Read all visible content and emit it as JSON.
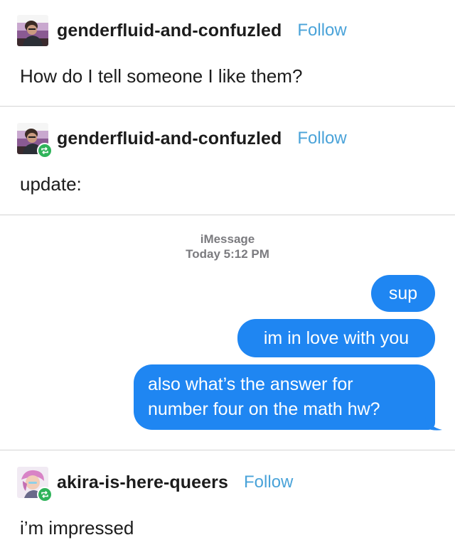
{
  "posts": [
    {
      "username": "genderfluid-and-confuzled",
      "follow_label": "Follow",
      "text": "How do I tell someone I like them?",
      "reblogged": false
    },
    {
      "username": "genderfluid-and-confuzled",
      "follow_label": "Follow",
      "text": "update:",
      "reblogged": true
    },
    {
      "username": "akira-is-here-queers",
      "follow_label": "Follow",
      "text": "i’m impressed",
      "reblogged": true
    }
  ],
  "imessage": {
    "service": "iMessage",
    "timestamp": "Today 5:12 PM",
    "messages": [
      {
        "lines": [
          "sup"
        ]
      },
      {
        "lines": [
          "im in love with you"
        ]
      },
      {
        "lines": [
          "also what’s the answer for",
          "number four on the math hw?"
        ]
      }
    ]
  },
  "colors": {
    "bubble_blue": "#1f86f2",
    "follow_blue": "#4aa3d9",
    "reblog_green": "#2fb35a",
    "divider": "#d4d4d4"
  },
  "icons": {
    "reblog_badge": "reblog-icon",
    "avatar_1": "avatar-icon",
    "avatar_2": "avatar-icon"
  }
}
